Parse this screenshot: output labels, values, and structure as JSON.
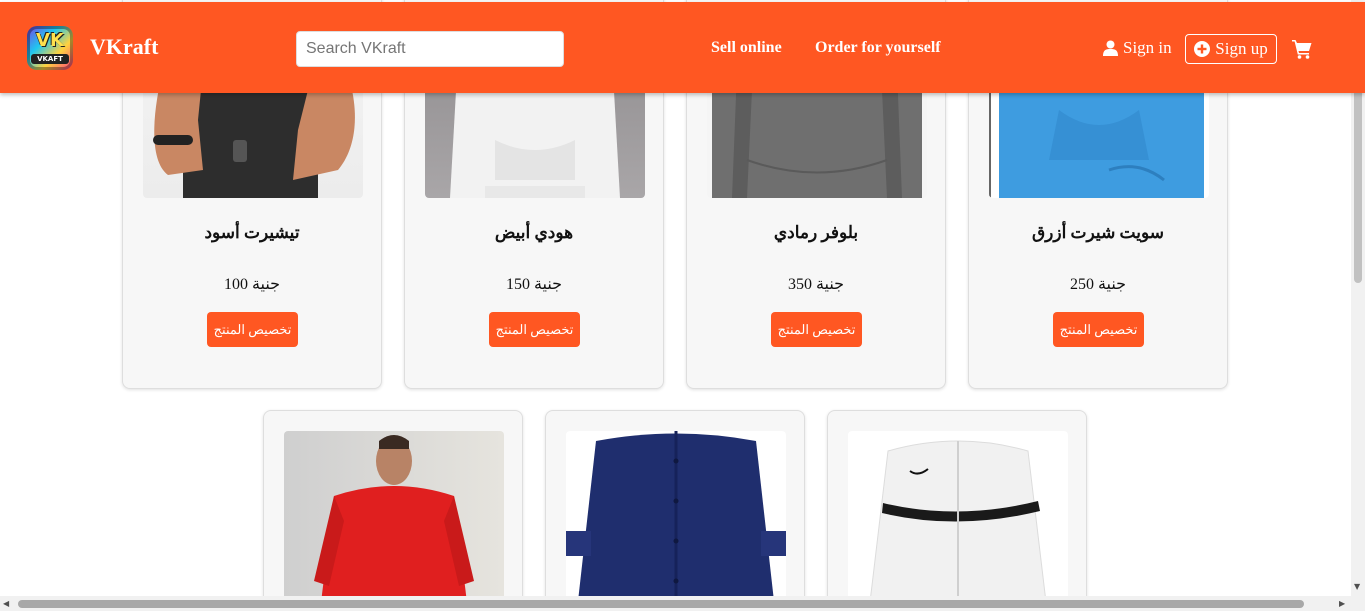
{
  "brand": {
    "logo_text": "VK",
    "logo_sub": "VKAFT",
    "name": "VKraft"
  },
  "search": {
    "placeholder": "Search VKraft",
    "value": ""
  },
  "nav": {
    "sell_online": "Sell online",
    "order_for_yourself": "Order for yourself"
  },
  "account": {
    "sign_in": "Sign in",
    "sign_up": "Sign up"
  },
  "icons": {
    "user": "user-icon",
    "plus": "plus-circle-icon",
    "cart": "shopping-cart-icon"
  },
  "colors": {
    "accent": "#ff5722",
    "card_bg": "#f7f7f7"
  },
  "products": [
    {
      "name": "تيشيرت أسود",
      "price": "جنية 100",
      "button": "تخصيص المنتج"
    },
    {
      "name": "هودي أبيض",
      "price": "جنية 150",
      "button": "تخصيص المنتج"
    },
    {
      "name": "بلوفر رمادي",
      "price": "جنية 350",
      "button": "تخصيص المنتج"
    },
    {
      "name": "سويت شيرت أزرق",
      "price": "جنية 250",
      "button": "تخصيص المنتج"
    }
  ]
}
